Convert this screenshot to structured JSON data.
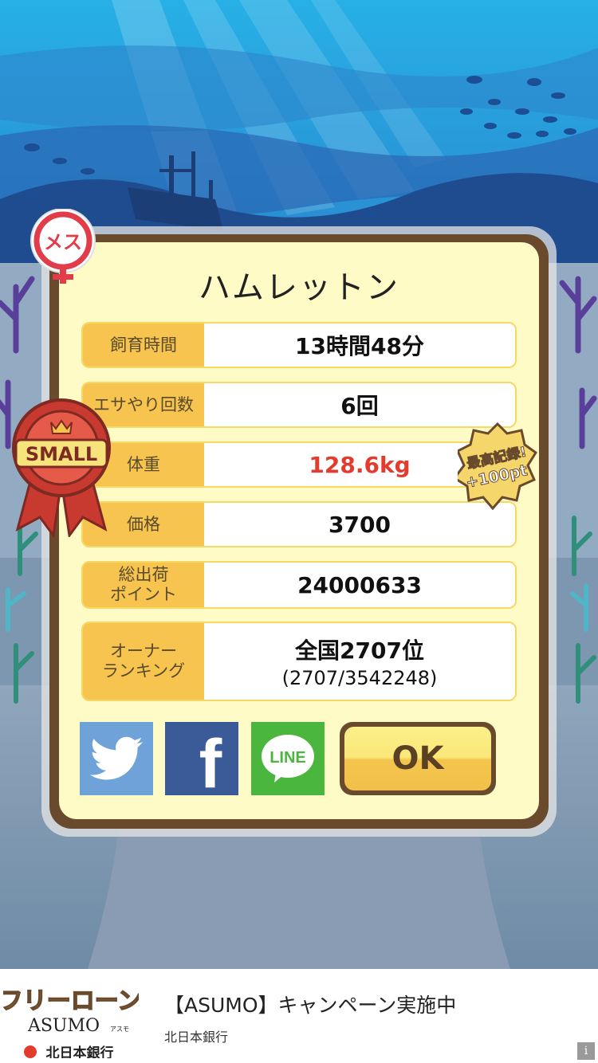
{
  "card": {
    "title": "ハムレットン",
    "gender_badge": "メス",
    "size_badge": "SMALL",
    "record_badge": {
      "line1": "最高記録!",
      "line2": "+100pt"
    },
    "rows": [
      {
        "label": "飼育時間",
        "value": "13時間48分"
      },
      {
        "label": "エサやり回数",
        "value": "6回"
      },
      {
        "label": "体重",
        "value": "128.6kg",
        "highlight_color": "#e23c2f"
      },
      {
        "label": "価格",
        "value": "3700"
      },
      {
        "label": "総出荷\nポイント",
        "value": "24000633"
      },
      {
        "label": "オーナー\nランキング",
        "value": "全国2707位",
        "sub": "(2707/3542248)"
      }
    ],
    "share": {
      "twitter_color": "#6fa2d8",
      "facebook_color": "#3b5a98",
      "facebook_letter": "f",
      "line_color": "#4bb63d",
      "line_text": "LINE"
    },
    "ok_label": "OK"
  },
  "ad": {
    "logo_line1": "フリーローン",
    "logo_line2": "ASUMO",
    "logo_kana": "アスモ",
    "logo_bank": "北日本銀行",
    "title": "【ASUMO】キャンペーン実施中",
    "advertiser": "北日本銀行",
    "info_icon": "i"
  }
}
